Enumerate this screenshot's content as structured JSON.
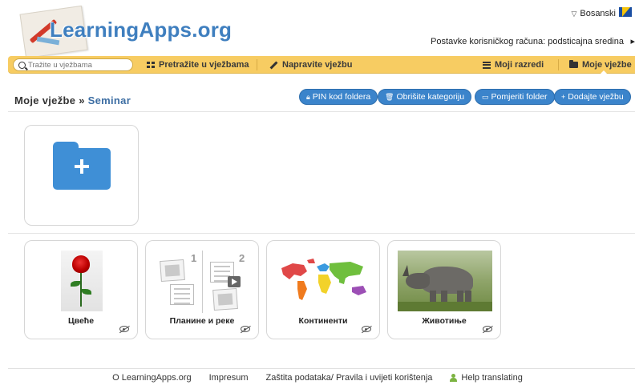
{
  "header": {
    "logo_text": "LearningApps.org",
    "language": "Bosanski",
    "account_text": "Postavke korisničkog računa: podsticajna sredina"
  },
  "toolbar": {
    "search_placeholder": "Tražite u vježbama",
    "search_label": "Pretražite u vježbama",
    "create_label": "Napravite vježbu",
    "classes_label": "Moji razredi",
    "my_apps_label": "Moje vježbe",
    "accent_color": "#f7cc62"
  },
  "breadcrumb": {
    "root": "Moje vježbe",
    "separator": "»",
    "current": "Seminar"
  },
  "actions": {
    "pin_label": "PIN kod foldera",
    "delete_label": "Obrišite kategoriju",
    "move_label": "Pomjeriti folder",
    "add_label": "Dodajte vježbu",
    "button_color": "#3b84cb"
  },
  "apps": [
    {
      "title": "Цвеће",
      "thumb": "red-rose-photo"
    },
    {
      "title": "Планине и реке",
      "thumb": "placeholder-pair-1-2"
    },
    {
      "title": "Континенти",
      "thumb": "world-map-continents"
    },
    {
      "title": "Животиње",
      "thumb": "rhino-photo"
    }
  ],
  "placeholder_numbers": [
    "1",
    "2"
  ],
  "footer": {
    "about": "O LearningApps.org",
    "imprint": "Impresum",
    "privacy": "Zaštita podataka/ Pravila i uvijeti korištenja",
    "help": "Help translating"
  }
}
